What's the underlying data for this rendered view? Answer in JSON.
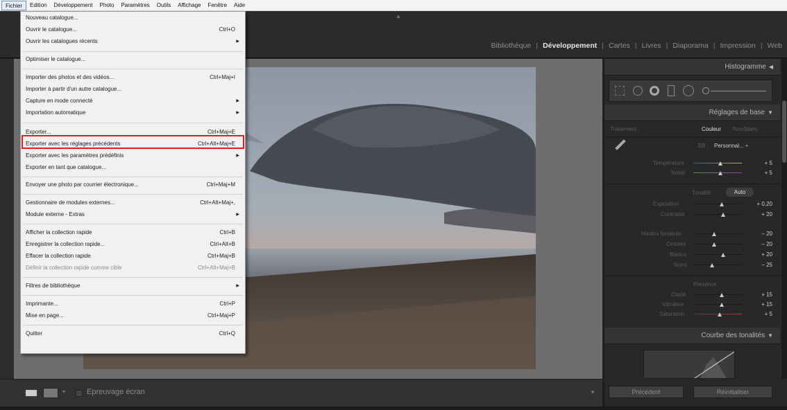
{
  "menubar": {
    "items": [
      "Fichier",
      "Edition",
      "Développement",
      "Photo",
      "Paramètres",
      "Outils",
      "Affichage",
      "Fenêtre",
      "Aide"
    ]
  },
  "modules": {
    "items": [
      "Bibliothèque",
      "Développement",
      "Cartes",
      "Livres",
      "Diaporama",
      "Impression",
      "Web"
    ],
    "active": "Développement"
  },
  "file_menu": {
    "items": [
      {
        "label": "Nouveau catalogue...",
        "shortcut": ""
      },
      {
        "label": "Ouvrir le catalogue...",
        "shortcut": "Ctrl+O"
      },
      {
        "label": "Ouvrir les catalogues récents",
        "shortcut": "",
        "submenu": true
      },
      {
        "label": "Optimiser le catalogue...",
        "shortcut": ""
      },
      {
        "label": "Importer des photos et des vidéos...",
        "shortcut": "Ctrl+Maj+I"
      },
      {
        "label": "Importer à partir d'un autre catalogue...",
        "shortcut": ""
      },
      {
        "label": "Capture en mode connecté",
        "shortcut": "",
        "submenu": true
      },
      {
        "label": "Importation automatique",
        "shortcut": "",
        "submenu": true
      },
      {
        "label": "Exporter...",
        "shortcut": "Ctrl+Maj+E"
      },
      {
        "label": "Exporter avec les réglages précédents",
        "shortcut": "Ctrl+Alt+Maj+E"
      },
      {
        "label": "Exporter avec les paramètres prédéfinis",
        "shortcut": "",
        "submenu": true
      },
      {
        "label": "Exporter en tant que catalogue...",
        "shortcut": ""
      },
      {
        "label": "Envoyer une photo par courrier électronique...",
        "shortcut": "Ctrl+Maj+M"
      },
      {
        "label": "Gestionnaire de modules externes...",
        "shortcut": "Ctrl+Alt+Maj+,"
      },
      {
        "label": "Module externe - Extras",
        "shortcut": "",
        "submenu": true
      },
      {
        "label": "Afficher la collection rapide",
        "shortcut": "Ctrl+B"
      },
      {
        "label": "Enregistrer la collection rapide...",
        "shortcut": "Ctrl+Alt+B"
      },
      {
        "label": "Effacer la collection rapide",
        "shortcut": "Ctrl+Maj+B"
      },
      {
        "label": "Définir la collection rapide comme cible",
        "shortcut": "Ctrl+Alt+Maj+B",
        "disabled": true
      },
      {
        "label": "Filtres de bibliothèque",
        "shortcut": "",
        "submenu": true
      },
      {
        "label": "Imprimante...",
        "shortcut": "Ctrl+P"
      },
      {
        "label": "Mise en page...",
        "shortcut": "Ctrl+Maj+P"
      },
      {
        "label": "Quitter",
        "shortcut": "Ctrl+Q"
      }
    ],
    "highlighted": "Exporter..."
  },
  "right_panel": {
    "histogram_title": "Histogramme",
    "basic_title": "Réglages de base",
    "treatment_label": "Traitement :",
    "treatment_color": "Couleur",
    "treatment_bw": "Noir/blanc",
    "wb_label": "BB :",
    "wb_value": "Personnal... ÷",
    "temperature_label": "Température",
    "temperature_value": "+ 5",
    "tint_label": "Teinte",
    "tint_value": "+ 5",
    "tone_label": "Tonalité",
    "auto_label": "Auto",
    "exposure_label": "Exposition",
    "exposure_value": "+ 0,20",
    "contrast_label": "Contraste",
    "contrast_value": "+ 20",
    "highlights_label": "Hautes lumières",
    "highlights_value": "– 20",
    "shadows_label": "Ombres",
    "shadows_value": "– 20",
    "whites_label": "Blancs",
    "whites_value": "+ 20",
    "blacks_label": "Noirs",
    "blacks_value": "– 25",
    "presence_label": "Présence",
    "clarity_label": "Clarté",
    "clarity_value": "+ 15",
    "vibrance_label": "Vibrance",
    "vibrance_value": "+ 15",
    "saturation_label": "Saturation",
    "saturation_value": "+ 5",
    "tone_curve_title": "Courbe des tonalités"
  },
  "bottom": {
    "softproof_label": "Epreuvage écran",
    "previous_button": "Précédent",
    "reset_button": "Réinitialiser"
  },
  "colors": {
    "highlight_border": "#e01b1b",
    "panel_bg": "#282828",
    "center_bg": "#6e6e6e",
    "menu_bg": "#f1f1f1"
  }
}
